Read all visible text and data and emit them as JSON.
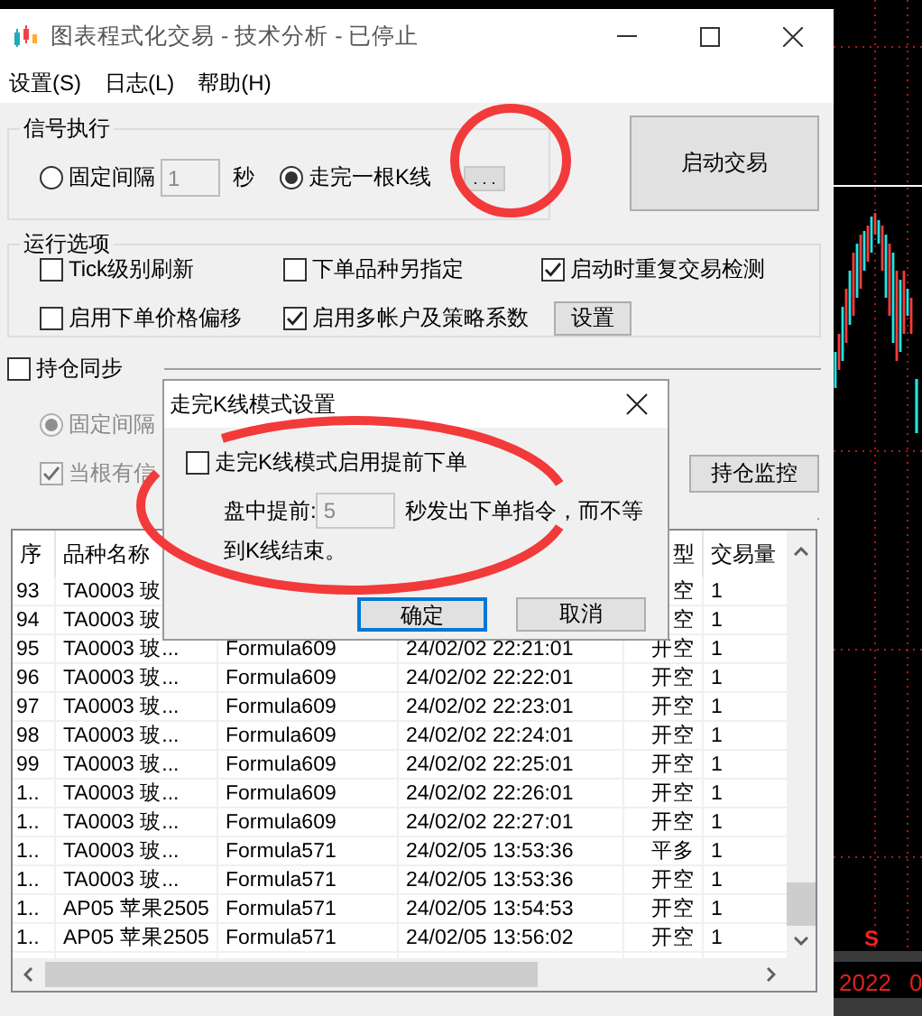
{
  "window": {
    "title": "图表程式化交易 - 技术分析 - 已停止"
  },
  "menu": [
    "设置(S)",
    "日志(L)",
    "帮助(H)"
  ],
  "signal": {
    "title": "信号执行",
    "options": [
      {
        "label": "固定间隔",
        "selected": false
      },
      {
        "label": "走完一根K线",
        "selected": true
      }
    ],
    "interval_value": "1",
    "interval_unit": "秒",
    "more_button": ". . ."
  },
  "start_button": "启动交易",
  "run_options": {
    "title": "运行选项",
    "checkboxes": [
      {
        "label": "Tick级别刷新",
        "checked": false
      },
      {
        "label": "下单品种另指定",
        "checked": false
      },
      {
        "label": "启动时重复交易检测",
        "checked": true
      },
      {
        "label": "启用下单价格偏移",
        "checked": false
      },
      {
        "label": "启用多帐户及策略系数",
        "checked": true
      }
    ],
    "settings_button": "设置"
  },
  "position_sync": {
    "label": "持仓同步",
    "checked": false,
    "mode": {
      "label": "固定间隔",
      "selected": true,
      "disabled": true
    },
    "signal_option": {
      "label": "当根有信",
      "checked": true,
      "disabled": true
    },
    "monitor_button": "持仓监控"
  },
  "table": {
    "columns": [
      "序",
      "品种名称",
      null,
      null,
      "型",
      "交易量"
    ],
    "rows": [
      {
        "cells": [
          "93",
          "TA0003 玻",
          null,
          null,
          "空",
          "1"
        ]
      },
      {
        "cells": [
          "94",
          "TA0003 玻",
          null,
          null,
          "空",
          "1"
        ]
      },
      {
        "cells": [
          "95",
          "TA0003 玻...",
          "Formula609",
          "24/02/02 22:21:01",
          "开空",
          "1"
        ]
      },
      {
        "cells": [
          "96",
          "TA0003 玻...",
          "Formula609",
          "24/02/02 22:22:01",
          "开空",
          "1"
        ]
      },
      {
        "cells": [
          "97",
          "TA0003 玻...",
          "Formula609",
          "24/02/02 22:23:01",
          "开空",
          "1"
        ]
      },
      {
        "cells": [
          "98",
          "TA0003 玻...",
          "Formula609",
          "24/02/02 22:24:01",
          "开空",
          "1"
        ]
      },
      {
        "cells": [
          "99",
          "TA0003 玻...",
          "Formula609",
          "24/02/02 22:25:01",
          "开空",
          "1"
        ]
      },
      {
        "cells": [
          "1..",
          "TA0003 玻...",
          "Formula609",
          "24/02/02 22:26:01",
          "开空",
          "1"
        ]
      },
      {
        "cells": [
          "1..",
          "TA0003 玻...",
          "Formula609",
          "24/02/02 22:27:01",
          "开空",
          "1"
        ]
      },
      {
        "cells": [
          "1..",
          "TA0003 玻...",
          "Formula571",
          "24/02/05 13:53:36",
          "平多",
          "1"
        ]
      },
      {
        "cells": [
          "1..",
          "TA0003 玻...",
          "Formula571",
          "24/02/05 13:53:36",
          "开空",
          "1"
        ]
      },
      {
        "cells": [
          "1..",
          "AP05 苹果2505",
          "Formula571",
          "24/02/05 13:54:53",
          "开空",
          "1"
        ]
      },
      {
        "cells": [
          "1..",
          "AP05 苹果2505",
          "Formula571",
          "24/02/05 13:56:02",
          "开空",
          "1"
        ]
      }
    ]
  },
  "dialog": {
    "title": "走完K线模式设置",
    "checkbox": {
      "label": "走完K线模式启用提前下单",
      "checked": false
    },
    "lead_label": "盘中提前:",
    "lead_value": "5",
    "lead_disabled": true,
    "lead_text_lines": [
      "秒发出下单指令，而不等",
      "到K线结束。"
    ],
    "buttons": [
      {
        "label": "确定",
        "focused": true
      },
      {
        "label": "取消",
        "focused": false
      }
    ]
  },
  "chart": {
    "year_label": "2022",
    "next_label": "0",
    "marker": "S"
  }
}
